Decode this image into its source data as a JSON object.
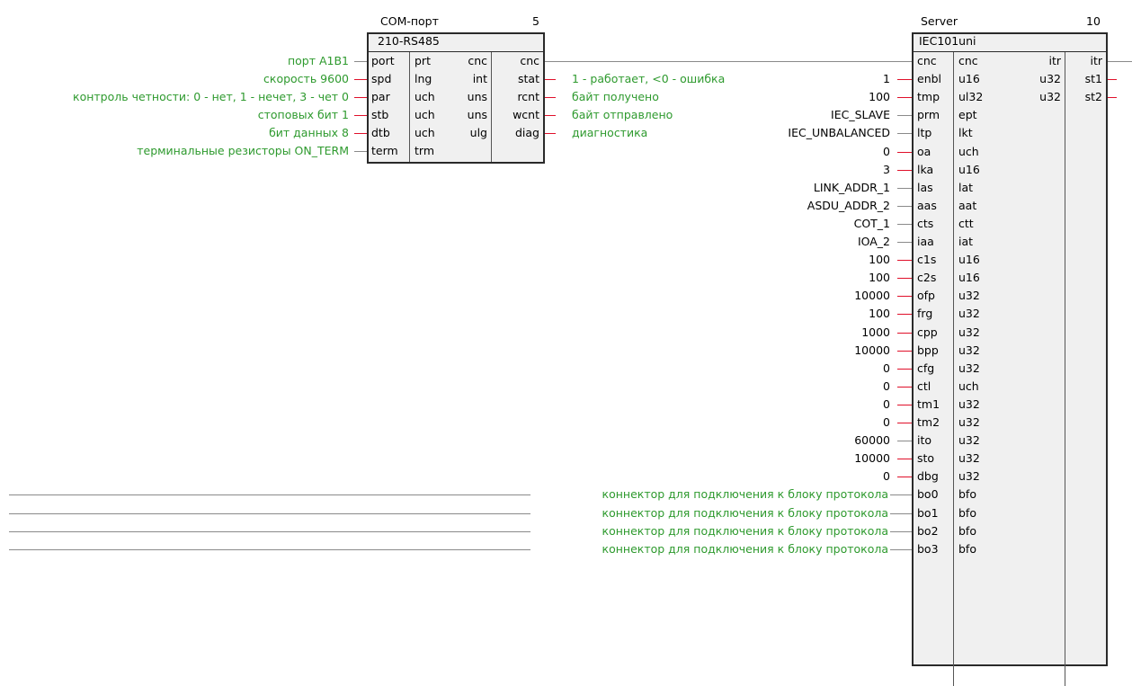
{
  "com_block": {
    "title": "COM-порт",
    "number": "5",
    "type": "210-RS485",
    "col_a": [
      "port",
      "spd",
      "par",
      "stb",
      "dtb",
      "term"
    ],
    "col_b": [
      "prt",
      "lng",
      "uch",
      "uch",
      "uch",
      "trm"
    ],
    "col_c": [
      "cnc",
      "int",
      "uns",
      "uns",
      "ulg",
      ""
    ],
    "col_d": [
      "cnc",
      "stat",
      "rcnt",
      "wcnt",
      "diag",
      ""
    ],
    "inputs": [
      "порт A1B1",
      "скорость 9600",
      "контроль четности: 0 - нет, 1 - нечет, 3 - чет 0",
      "стоповых бит 1",
      "бит данных 8",
      "терминальные резисторы ON_TERM"
    ],
    "outputs": [
      "",
      "1 - работает, <0 - ошибка",
      "байт получено",
      "байт отправлено",
      "диагностика",
      ""
    ]
  },
  "server_block": {
    "title": "Server",
    "number": "10",
    "type": "IEC101uni",
    "col_a": [
      "cnc",
      "enbl",
      "tmp",
      "prm",
      "ltp",
      "oa",
      "lka",
      "las",
      "aas",
      "cts",
      "iaa",
      "c1s",
      "c2s",
      "ofp",
      "frg",
      "cpp",
      "bpp",
      "cfg",
      "ctl",
      "tm1",
      "tm2",
      "ito",
      "sto",
      "dbg",
      "bo0",
      "bo1",
      "bo2",
      "bo3"
    ],
    "col_b": [
      "cnc",
      "u16",
      "ul32",
      "ept",
      "lkt",
      "uch",
      "u16",
      "lat",
      "aat",
      "ctt",
      "iat",
      "u16",
      "u16",
      "u32",
      "u32",
      "u32",
      "u32",
      "u32",
      "uch",
      "u32",
      "u32",
      "u32",
      "u32",
      "u32",
      "bfo",
      "bfo",
      "bfo",
      "bfo"
    ],
    "col_c": [
      "itr",
      "u32",
      "u32"
    ],
    "col_d": [
      "itr",
      "st1",
      "st2"
    ],
    "inputs": [
      "",
      "1",
      "100",
      "IEC_SLAVE",
      "IEC_UNBALANCED",
      "0",
      "3",
      "LINK_ADDR_1",
      "ASDU_ADDR_2",
      "COT_1",
      "IOA_2",
      "100",
      "100",
      "10000",
      "100",
      "1000",
      "10000",
      "0",
      "0",
      "0",
      "0",
      "60000",
      "10000",
      "0",
      "",
      "",
      "",
      ""
    ],
    "connector_labels": [
      "коннектор для подключения к блоку протокола",
      "коннектор для подключения к блоку протокола",
      "коннектор для подключения к блоку протокола",
      "коннектор для подключения к блоку протокола"
    ]
  },
  "colors": {
    "param_text": "#2e9a2e",
    "wire_red": "#e0102a",
    "block_fill": "#f0f0f0"
  }
}
